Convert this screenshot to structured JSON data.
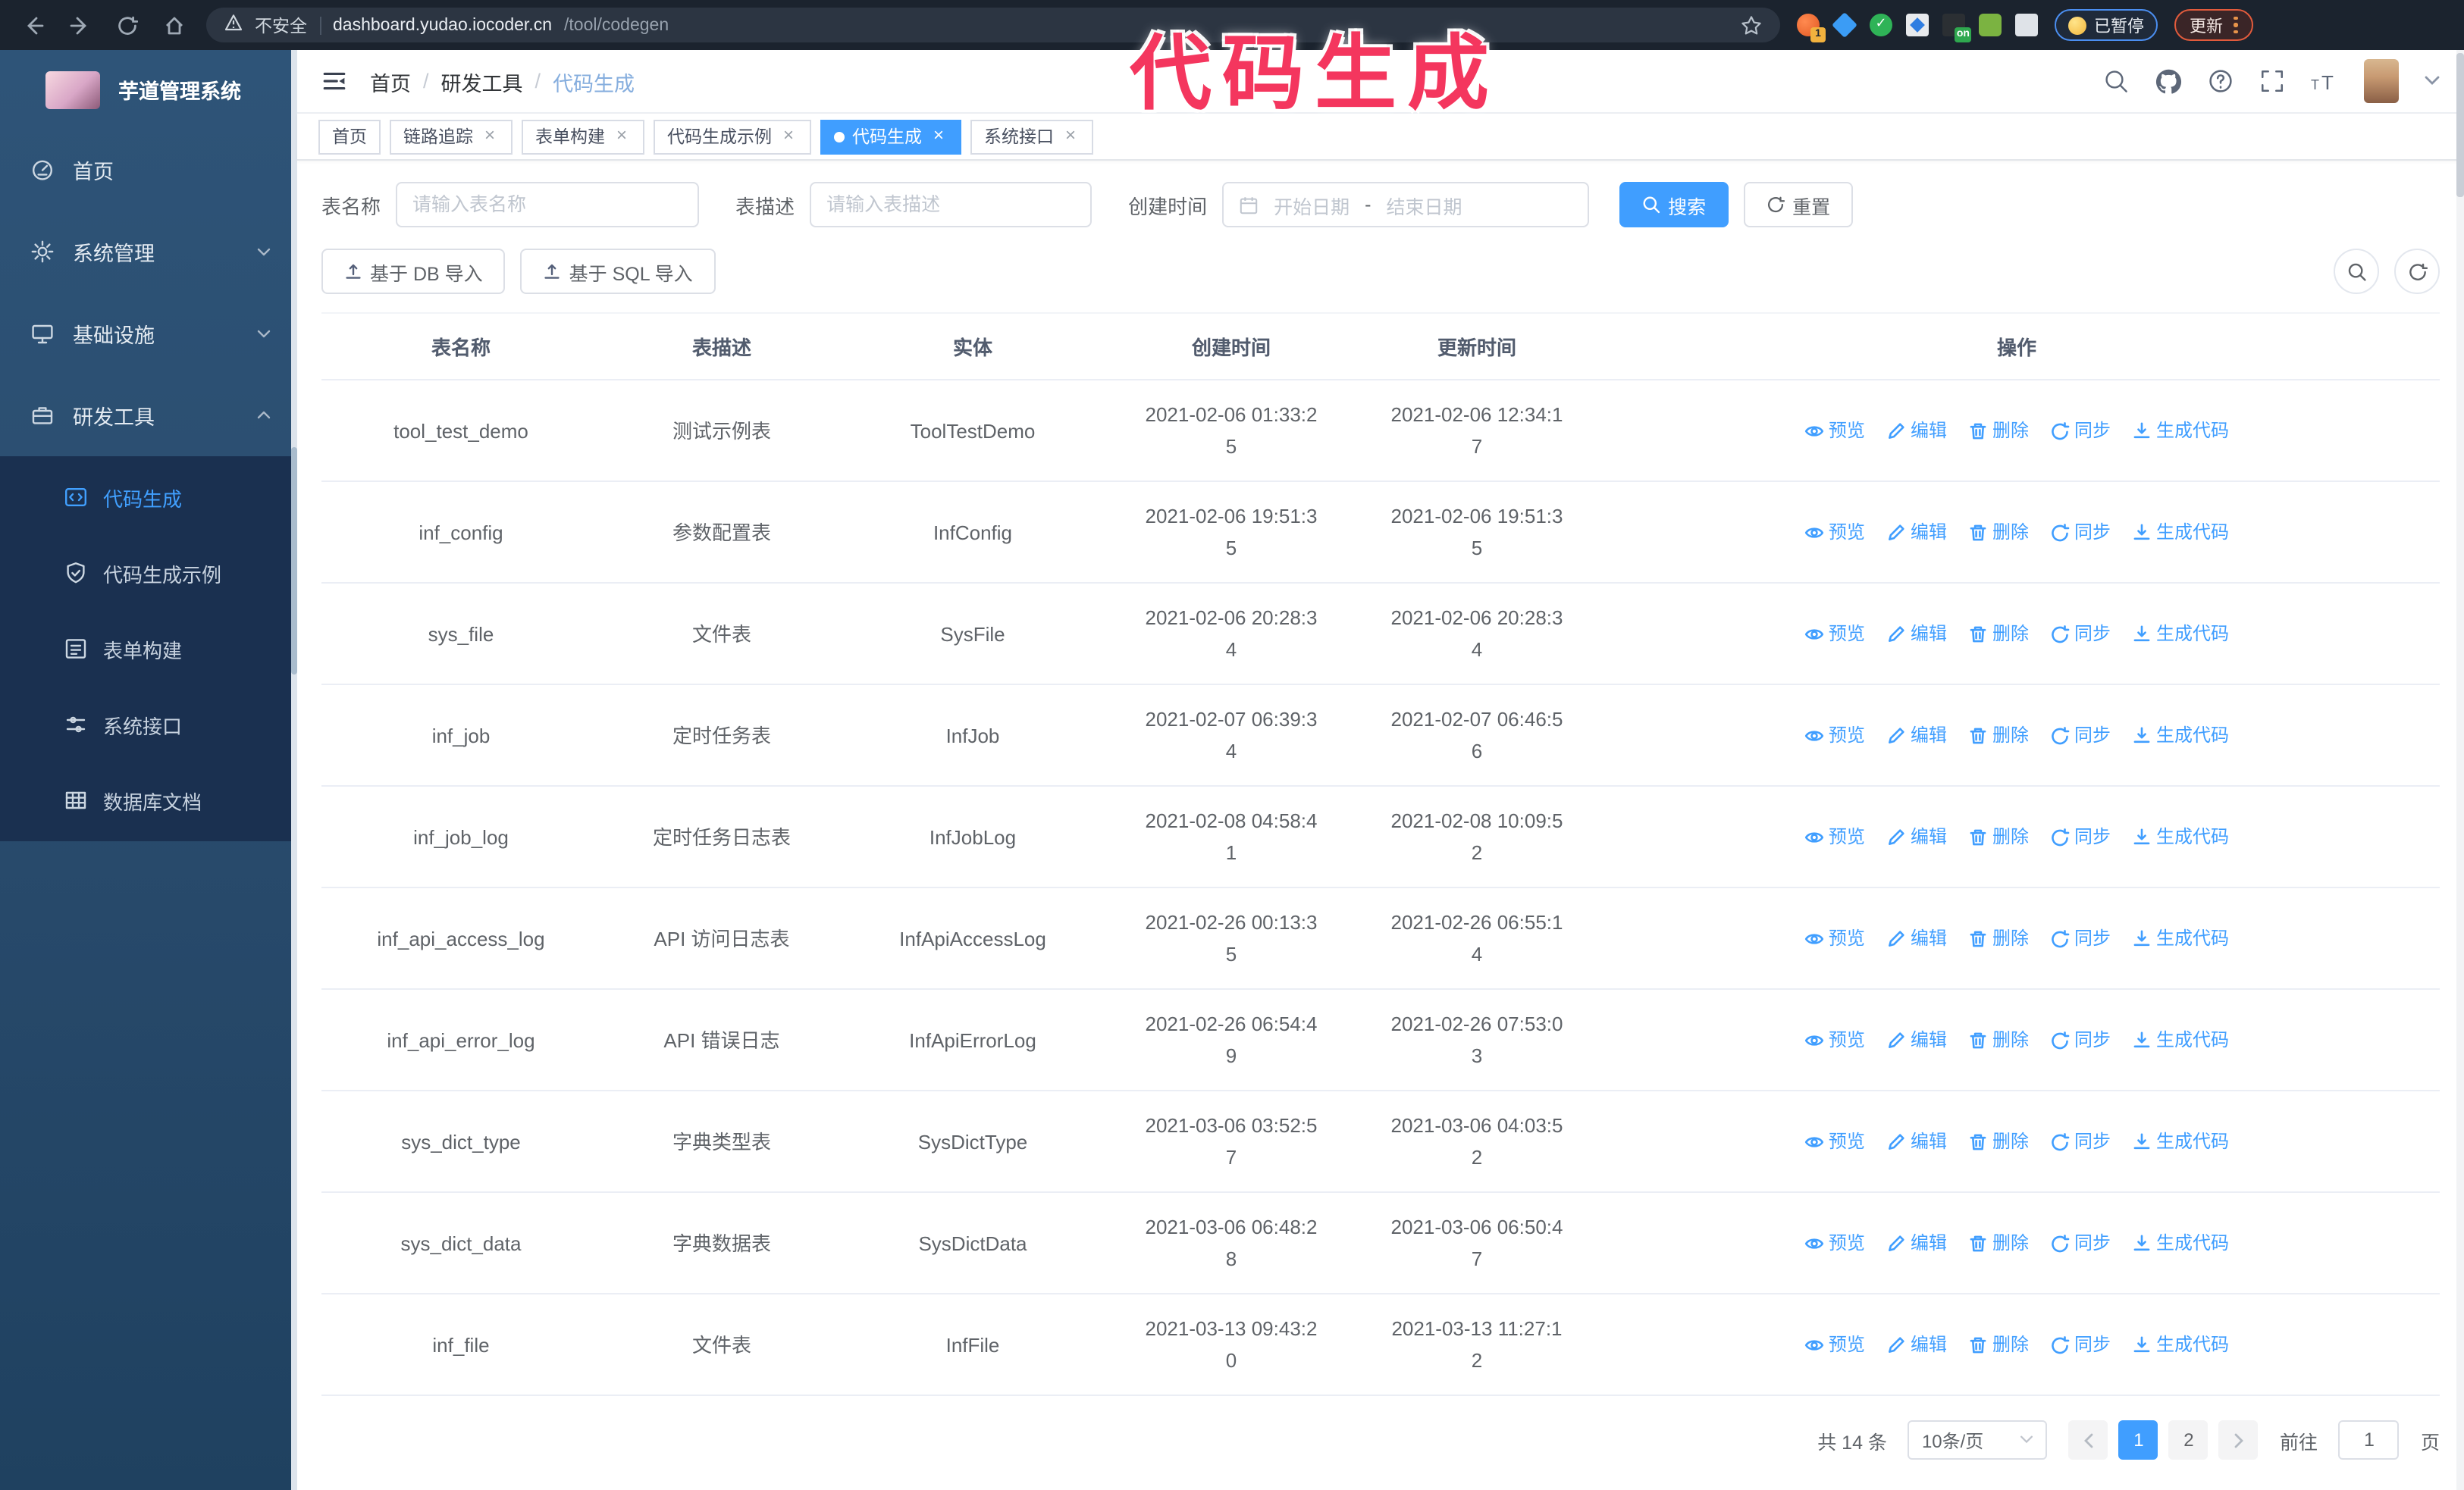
{
  "browser": {
    "security_warning": "不安全",
    "url_host": "dashboard.yudao.iocoder.cn",
    "url_path": "/tool/codegen",
    "paused_label": "已暂停",
    "update_label": "更新",
    "extensions": [
      {
        "name": "ext-orange-icon",
        "badge": "1",
        "badge_bg": "#f2b23e"
      },
      {
        "name": "ext-gem-icon"
      },
      {
        "name": "ext-green-check-icon"
      },
      {
        "name": "ext-grid-icon"
      },
      {
        "name": "ext-onoff-icon",
        "badge": "on",
        "badge_bg": "#2fa84f"
      },
      {
        "name": "ext-green-bot-icon"
      },
      {
        "name": "ext-puzzle-icon"
      }
    ]
  },
  "annotation": {
    "text": "代码生成",
    "color": "#f4365e"
  },
  "sidebar": {
    "app_title": "芋道管理系统",
    "items": [
      {
        "key": "home",
        "label": "首页",
        "icon": "dashboard-icon",
        "chevron": null
      },
      {
        "key": "system",
        "label": "系统管理",
        "icon": "gear-icon",
        "chevron": "down"
      },
      {
        "key": "infra",
        "label": "基础设施",
        "icon": "monitor-icon",
        "chevron": "down"
      },
      {
        "key": "devtools",
        "label": "研发工具",
        "icon": "toolbox-icon",
        "chevron": "up",
        "expanded": true
      }
    ],
    "submenu": [
      {
        "key": "codegen",
        "label": "代码生成",
        "icon": "code-icon",
        "active": true
      },
      {
        "key": "codegen-example",
        "label": "代码生成示例",
        "icon": "example-icon",
        "active": false
      },
      {
        "key": "form-builder",
        "label": "表单构建",
        "icon": "form-icon",
        "active": false
      },
      {
        "key": "system-api",
        "label": "系统接口",
        "icon": "api-icon",
        "active": false
      },
      {
        "key": "db-doc",
        "label": "数据库文档",
        "icon": "dbdoc-icon",
        "active": false
      }
    ]
  },
  "header": {
    "breadcrumb": [
      "首页",
      "研发工具",
      "代码生成"
    ],
    "breadcrumb_separator": "/",
    "icons": [
      "search-icon",
      "github-icon",
      "help-icon",
      "fullscreen-icon",
      "font-size-icon"
    ]
  },
  "tabs": [
    {
      "label": "首页",
      "closable": false,
      "active": false
    },
    {
      "label": "链路追踪",
      "closable": true,
      "active": false
    },
    {
      "label": "表单构建",
      "closable": true,
      "active": false
    },
    {
      "label": "代码生成示例",
      "closable": true,
      "active": false
    },
    {
      "label": "代码生成",
      "closable": true,
      "active": true
    },
    {
      "label": "系统接口",
      "closable": true,
      "active": false
    }
  ],
  "filters": {
    "name_label": "表名称",
    "name_placeholder": "请输入表名称",
    "desc_label": "表描述",
    "desc_placeholder": "请输入表描述",
    "created_label": "创建时间",
    "date_start_placeholder": "开始日期",
    "date_separator": "-",
    "date_end_placeholder": "结束日期",
    "search_label": "搜索",
    "reset_label": "重置"
  },
  "toolbar": {
    "import_db_label": "基于 DB 导入",
    "import_sql_label": "基于 SQL 导入"
  },
  "table": {
    "columns": [
      "表名称",
      "表描述",
      "实体",
      "创建时间",
      "更新时间",
      "操作"
    ],
    "actions": [
      {
        "label": "预览",
        "icon": "eye-icon"
      },
      {
        "label": "编辑",
        "icon": "edit-icon"
      },
      {
        "label": "删除",
        "icon": "delete-icon"
      },
      {
        "label": "同步",
        "icon": "sync-icon"
      },
      {
        "label": "生成代码",
        "icon": "download-icon"
      }
    ],
    "rows": [
      {
        "name": "tool_test_demo",
        "desc": "测试示例表",
        "entity": "ToolTestDemo",
        "created": "2021-02-06 01:33:25",
        "updated": "2021-02-06 12:34:17"
      },
      {
        "name": "inf_config",
        "desc": "参数配置表",
        "entity": "InfConfig",
        "created": "2021-02-06 19:51:35",
        "updated": "2021-02-06 19:51:35"
      },
      {
        "name": "sys_file",
        "desc": "文件表",
        "entity": "SysFile",
        "created": "2021-02-06 20:28:34",
        "updated": "2021-02-06 20:28:34"
      },
      {
        "name": "inf_job",
        "desc": "定时任务表",
        "entity": "InfJob",
        "created": "2021-02-07 06:39:34",
        "updated": "2021-02-07 06:46:56"
      },
      {
        "name": "inf_job_log",
        "desc": "定时任务日志表",
        "entity": "InfJobLog",
        "created": "2021-02-08 04:58:41",
        "updated": "2021-02-08 10:09:52"
      },
      {
        "name": "inf_api_access_log",
        "desc": "API 访问日志表",
        "entity": "InfApiAccessLog",
        "created": "2021-02-26 00:13:35",
        "updated": "2021-02-26 06:55:14"
      },
      {
        "name": "inf_api_error_log",
        "desc": "API 错误日志",
        "entity": "InfApiErrorLog",
        "created": "2021-02-26 06:54:49",
        "updated": "2021-02-26 07:53:03"
      },
      {
        "name": "sys_dict_type",
        "desc": "字典类型表",
        "entity": "SysDictType",
        "created": "2021-03-06 03:52:57",
        "updated": "2021-03-06 04:03:52"
      },
      {
        "name": "sys_dict_data",
        "desc": "字典数据表",
        "entity": "SysDictData",
        "created": "2021-03-06 06:48:28",
        "updated": "2021-03-06 06:50:47"
      },
      {
        "name": "inf_file",
        "desc": "文件表",
        "entity": "InfFile",
        "created": "2021-03-13 09:43:20",
        "updated": "2021-03-13 11:27:12"
      }
    ]
  },
  "pagination": {
    "total_text": "共 14 条",
    "page_size": "10条/页",
    "pages": [
      "1",
      "2"
    ],
    "active_page": "1",
    "goto_label": "前往",
    "goto_value": "1",
    "goto_suffix": "页"
  },
  "colors": {
    "accent": "#409eff",
    "sidebar_bg": "#2a4c6e",
    "submenu_bg": "#1a3050",
    "annotation": "#f4365e",
    "browser_bar": "#1b232e"
  }
}
